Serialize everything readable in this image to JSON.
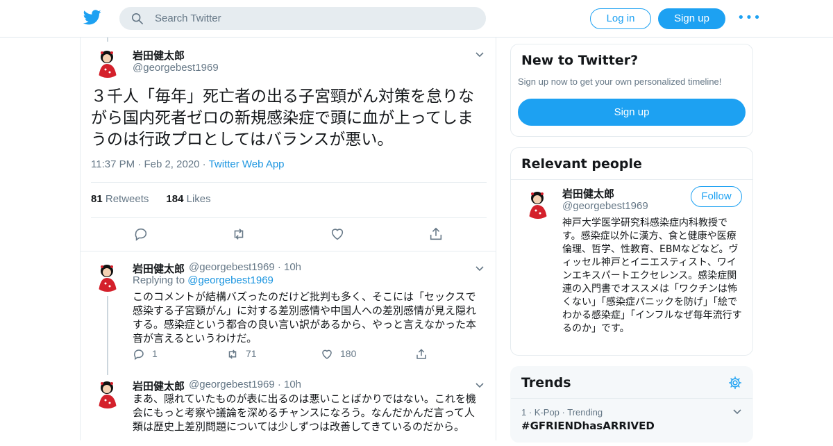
{
  "topbar": {
    "search_placeholder": "Search Twitter",
    "login_label": "Log in",
    "signup_label": "Sign up",
    "more_glyph": "•••"
  },
  "tweet": {
    "author_name": "岩田健太郎",
    "author_handle": "@georgebest1969",
    "text": "３千人「毎年」死亡者の出る子宮頸がん対策を怠りながら国内死者ゼロの新規感染症で頭に血が上ってしまうのは行政プロとしてはバランスが悪い。",
    "time": "11:37 PM",
    "sep": "·",
    "date": "Feb 2, 2020",
    "source": "Twitter Web App",
    "retweets_count": "81",
    "retweets_label": "Retweets",
    "likes_count": "184",
    "likes_label": "Likes"
  },
  "replies": [
    {
      "author_name": "岩田健太郎",
      "author_handle": "@georgebest1969",
      "sep": "·",
      "time": "10h",
      "replying_prefix": "Replying to",
      "replying_to": "@georgebest1969",
      "text": "このコメントが結構バズったのだけど批判も多く、そこには「セックスで感染する子宮頸がん」に対する差別感情や中国人への差別感情が見え隠れする。感染症という都合の良い言い訳があるから、やっと言えなかった本音が言えるというわけだ。",
      "reply_count": "1",
      "retweet_count": "71",
      "like_count": "180"
    },
    {
      "author_name": "岩田健太郎",
      "author_handle": "@georgebest1969",
      "sep": "·",
      "time": "10h",
      "text": "まあ、隠れていたものが表に出るのは悪いことばかりではない。これを機会にもっと考察や議論を深めるチャンスになろう。なんだかんだ言って人類は歴史上差別問題については少しずつは改善してきているのだから。"
    }
  ],
  "sidebar": {
    "new_title": "New to Twitter?",
    "new_sub": "Sign up now to get your own personalized timeline!",
    "new_signup": "Sign up",
    "relevant_title": "Relevant people",
    "person_name": "岩田健太郎",
    "person_handle": "@georgebest1969",
    "follow_label": "Follow",
    "person_bio": "神戸大学医学研究科感染症内科教授です。感染症以外に漢方、食と健康や医療倫理、哲学、性教育、EBMなどなど。ヴィッセル神戸とイニエスティスト、ワインエキスパートエクセレンス。感染症関連の入門書でオススメは「ワクチンは怖くない」「感染症パニックを防げ」「絵でわかる感染症」「インフルなぜ毎年流行するのか」です。",
    "trends_title": "Trends",
    "trend1_meta": "1 · K-Pop · Trending",
    "trend1_name": "#GFRIENDhasARRIVED"
  },
  "colors": {
    "accent": "#1da1f2",
    "secondary_text": "#657786",
    "border": "#e6ecf0"
  }
}
